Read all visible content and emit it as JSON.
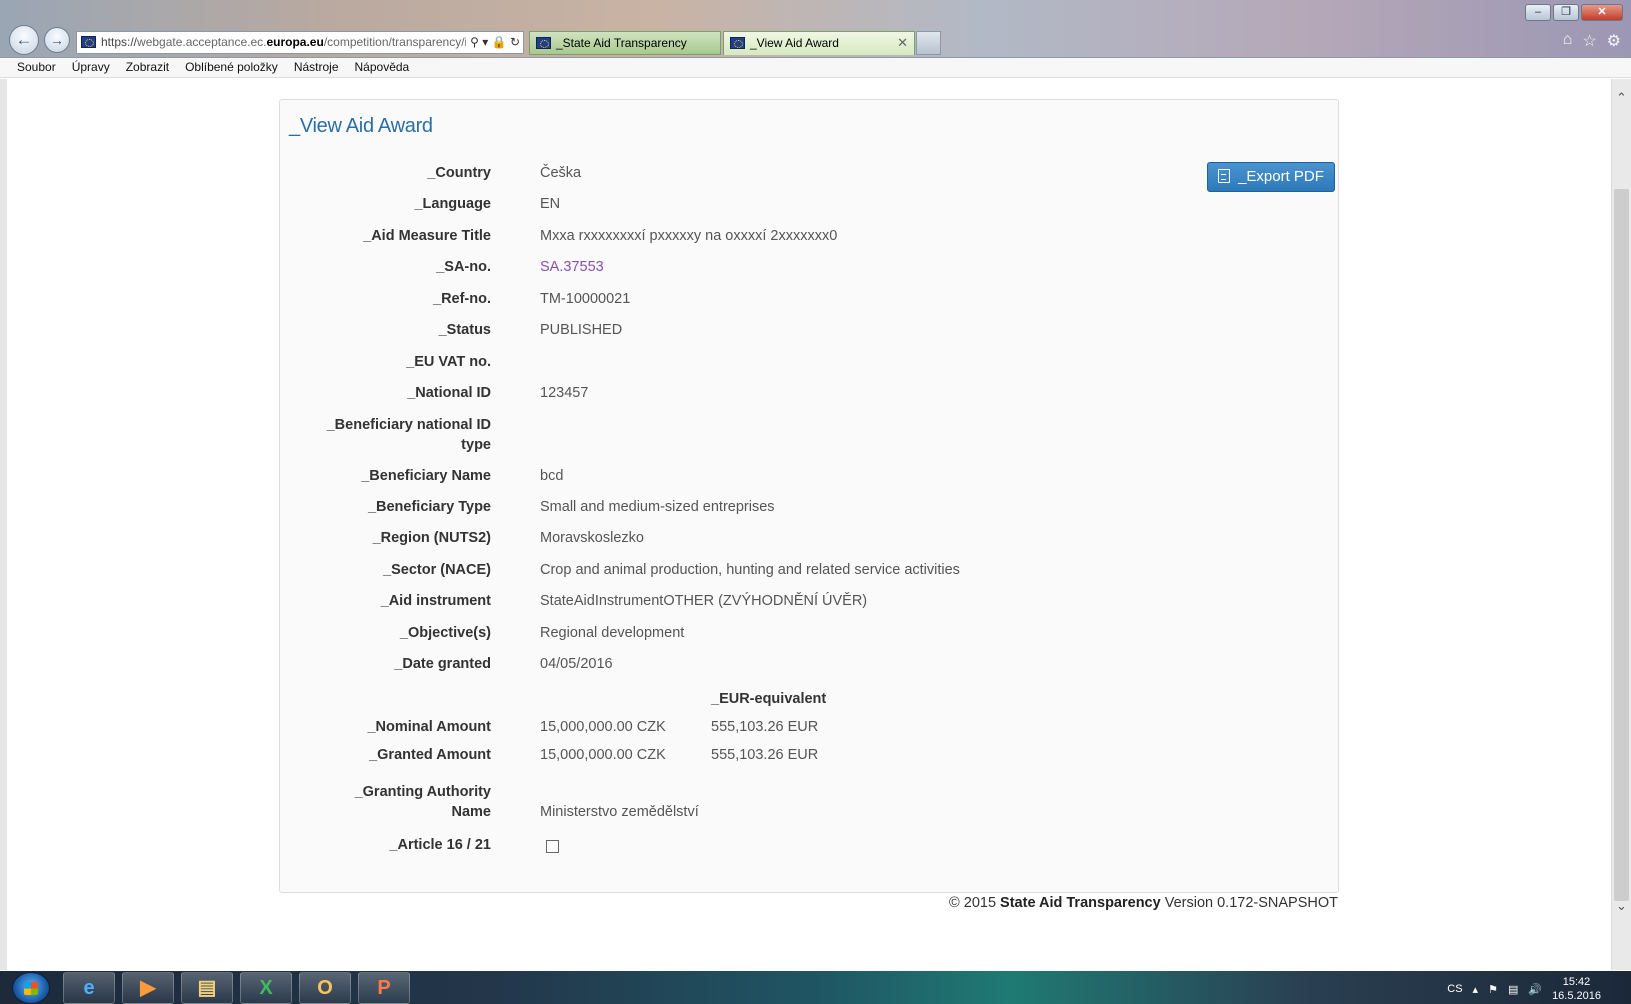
{
  "browser": {
    "address": {
      "scheme": "https://",
      "host_pre": "webgate.acceptance.ec.",
      "host_main": "europa.eu",
      "path": "/competition/transparency/i"
    },
    "tabs": [
      {
        "label": "_State Aid Transparency"
      },
      {
        "label": "_View Aid Award"
      }
    ]
  },
  "menu": [
    "Soubor",
    "Úpravy",
    "Zobrazit",
    "Oblíbené položky",
    "Nástroje",
    "Nápověda"
  ],
  "panel": {
    "title": "_View Aid Award",
    "export_label": "_Export PDF"
  },
  "fields": {
    "country": {
      "label": "_Country",
      "value": "Češka"
    },
    "language": {
      "label": "_Language",
      "value": "EN"
    },
    "title": {
      "label": "_Aid Measure Title",
      "value": "Mxxa rxxxxxxxxí pxxxxxy na oxxxxí 2xxxxxxx0"
    },
    "sa_no": {
      "label": "_SA-no.",
      "value": "SA.37553"
    },
    "ref_no": {
      "label": "_Ref-no.",
      "value": "TM-10000021"
    },
    "status": {
      "label": "_Status",
      "value": "PUBLISHED"
    },
    "vat": {
      "label": "_EU VAT no.",
      "value": ""
    },
    "national_id": {
      "label": "_National ID",
      "value": "123457"
    },
    "ben_id_type": {
      "label_1": "_Beneficiary national ID",
      "label_2": "type",
      "value": ""
    },
    "ben_name": {
      "label": "_Beneficiary Name",
      "value": "bcd"
    },
    "ben_type": {
      "label": "_Beneficiary Type",
      "value": "Small and medium-sized entreprises"
    },
    "region": {
      "label": "_Region (NUTS2)",
      "value": "Moravskoslezko"
    },
    "sector": {
      "label": "_Sector (NACE)",
      "value": "Crop and animal production, hunting and related service activities"
    },
    "instrument": {
      "label": "_Aid instrument",
      "value": "StateAidInstrumentOTHER (ZVÝHODNĚNÍ ÚVĚR)"
    },
    "objective": {
      "label": "_Objective(s)",
      "value": "Regional development"
    },
    "date": {
      "label": "_Date granted",
      "value": "04/05/2016"
    },
    "eur_header": "_EUR-equivalent",
    "nominal": {
      "label": "_Nominal Amount",
      "value": "15,000,000.00 CZK",
      "eur": "555,103.26 EUR"
    },
    "granted": {
      "label": "_Granted Amount",
      "value": "15,000,000.00 CZK",
      "eur": "555,103.26 EUR"
    },
    "authority": {
      "label_1": "_Granting Authority",
      "label_2": "Name",
      "value": "Ministerstvo zemědělství"
    },
    "article": {
      "label": "_Article 16 / 21",
      "checked": false
    }
  },
  "footer": {
    "copyright": "© 2015 ",
    "app_name": "State Aid Transparency",
    "version": " Version 0.172-SNAPSHOT"
  },
  "taskbar": {
    "apps": [
      "Internet Explorer",
      "Windows Media Player",
      "Windows Explorer",
      "Excel",
      "Outlook",
      "PowerPoint"
    ],
    "lang": "CS",
    "time": "15:42",
    "date": "16.5.2016"
  }
}
